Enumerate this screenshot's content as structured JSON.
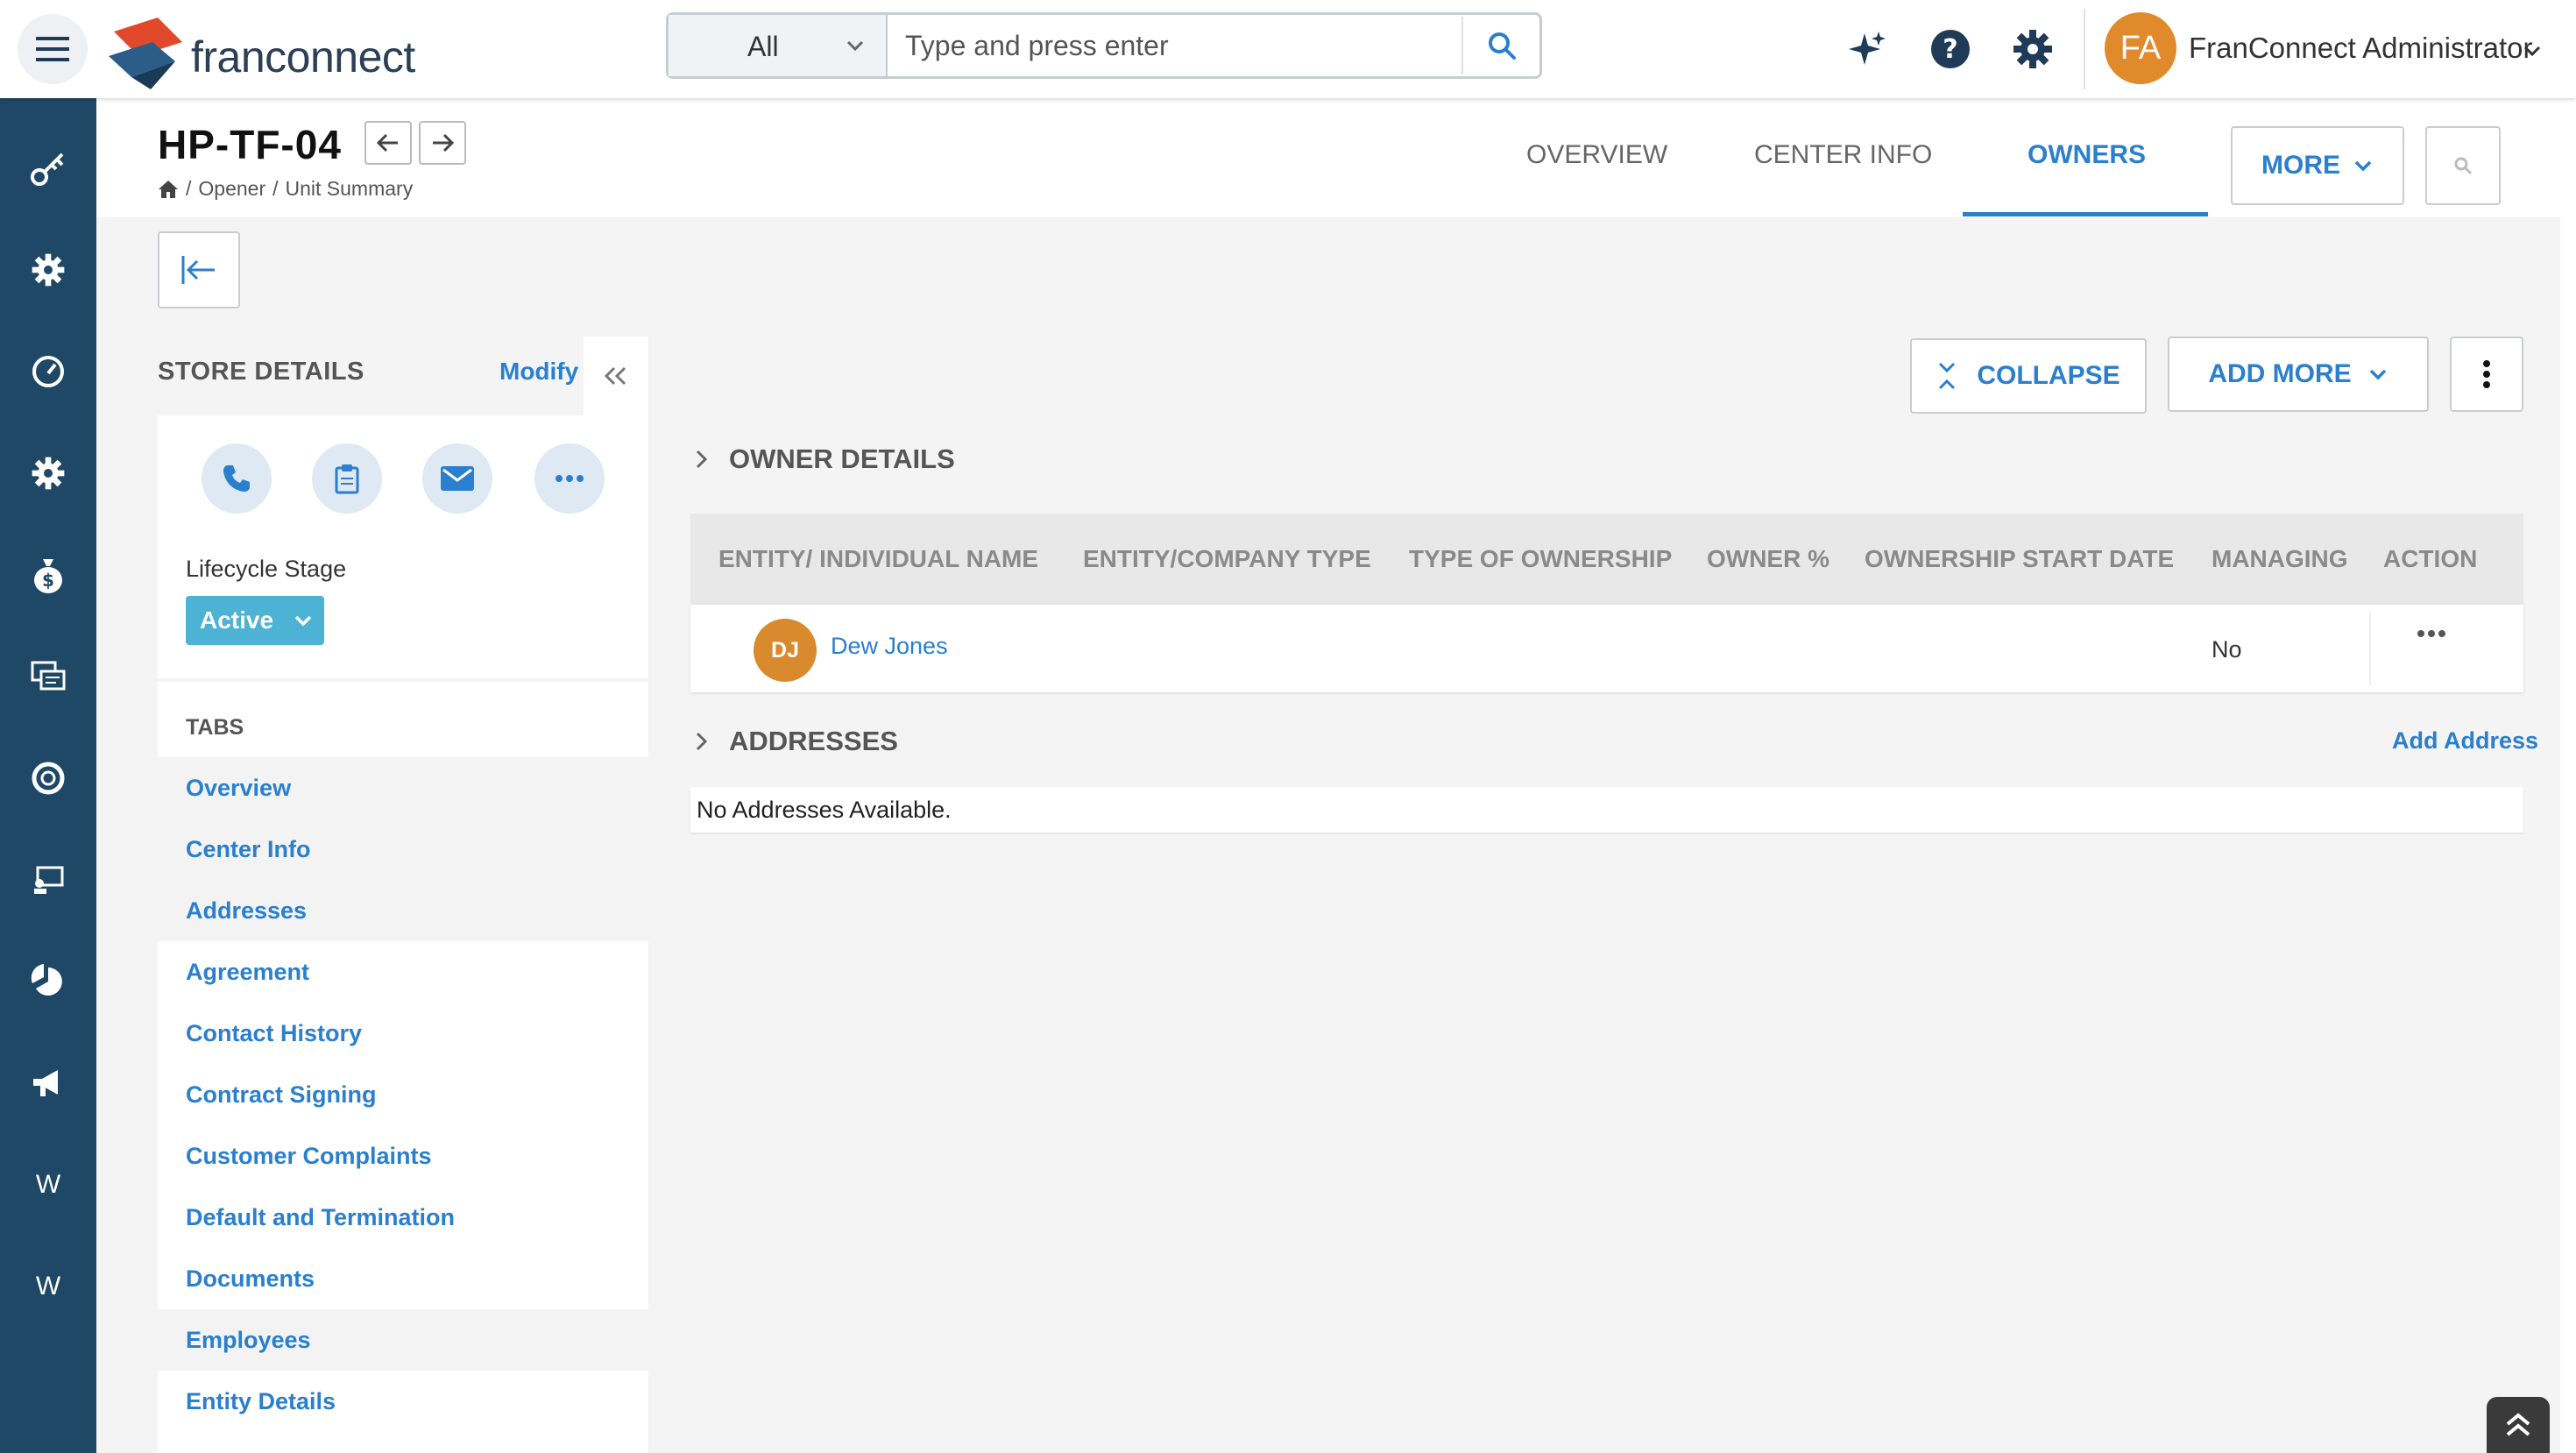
{
  "app": {
    "logo_text": "franconnect",
    "search": {
      "scope": "All",
      "placeholder": "Type and press enter"
    },
    "user": {
      "initials": "FA",
      "name": "FranConnect Administrator"
    },
    "colors": {
      "accent": "#2a7fce",
      "nav_bg": "#1f4766",
      "avatar": "#e08a2b",
      "status_active": "#4cb3d4"
    }
  },
  "leftnav": {
    "items": [
      "key-icon",
      "gear-icon",
      "dashboard-icon",
      "settings-icon",
      "money-bag-icon",
      "chat-icon",
      "support-icon",
      "training-icon",
      "analytics-icon",
      "megaphone-icon",
      "W",
      "W"
    ]
  },
  "header": {
    "title": "HP-TF-04",
    "breadcrumb": [
      "Opener",
      "Unit Summary"
    ],
    "tabs": [
      {
        "label": "OVERVIEW",
        "active": false
      },
      {
        "label": "CENTER INFO",
        "active": false
      },
      {
        "label": "OWNERS",
        "active": true
      }
    ],
    "more_label": "MORE"
  },
  "store_details": {
    "title": "STORE DETAILS",
    "modify_label": "Modify",
    "lifecycle_label": "Lifecycle Stage",
    "lifecycle_value": "Active",
    "tabs_heading": "TABS",
    "tabs": [
      "Overview",
      "Center Info",
      "Addresses",
      "Agreement",
      "Contact History",
      "Contract Signing",
      "Customer Complaints",
      "Default and Termination",
      "Documents",
      "Employees",
      "Entity Details"
    ]
  },
  "owners": {
    "collapse_label": "COLLAPSE",
    "add_more_label": "ADD MORE",
    "owner_details_title": "OWNER DETAILS",
    "columns": [
      "ENTITY/ INDIVIDUAL NAME",
      "ENTITY/COMPANY TYPE",
      "TYPE OF OWNERSHIP",
      "OWNER %",
      "OWNERSHIP START DATE",
      "MANAGING O",
      "ACTION"
    ],
    "rows": [
      {
        "initials": "DJ",
        "name": "Dew Jones",
        "company_type": "",
        "ownership_type": "",
        "owner_pct": "",
        "start_date": "",
        "managing": "No"
      }
    ],
    "addresses_title": "ADDRESSES",
    "add_address_label": "Add Address",
    "no_addresses": "No Addresses Available."
  }
}
